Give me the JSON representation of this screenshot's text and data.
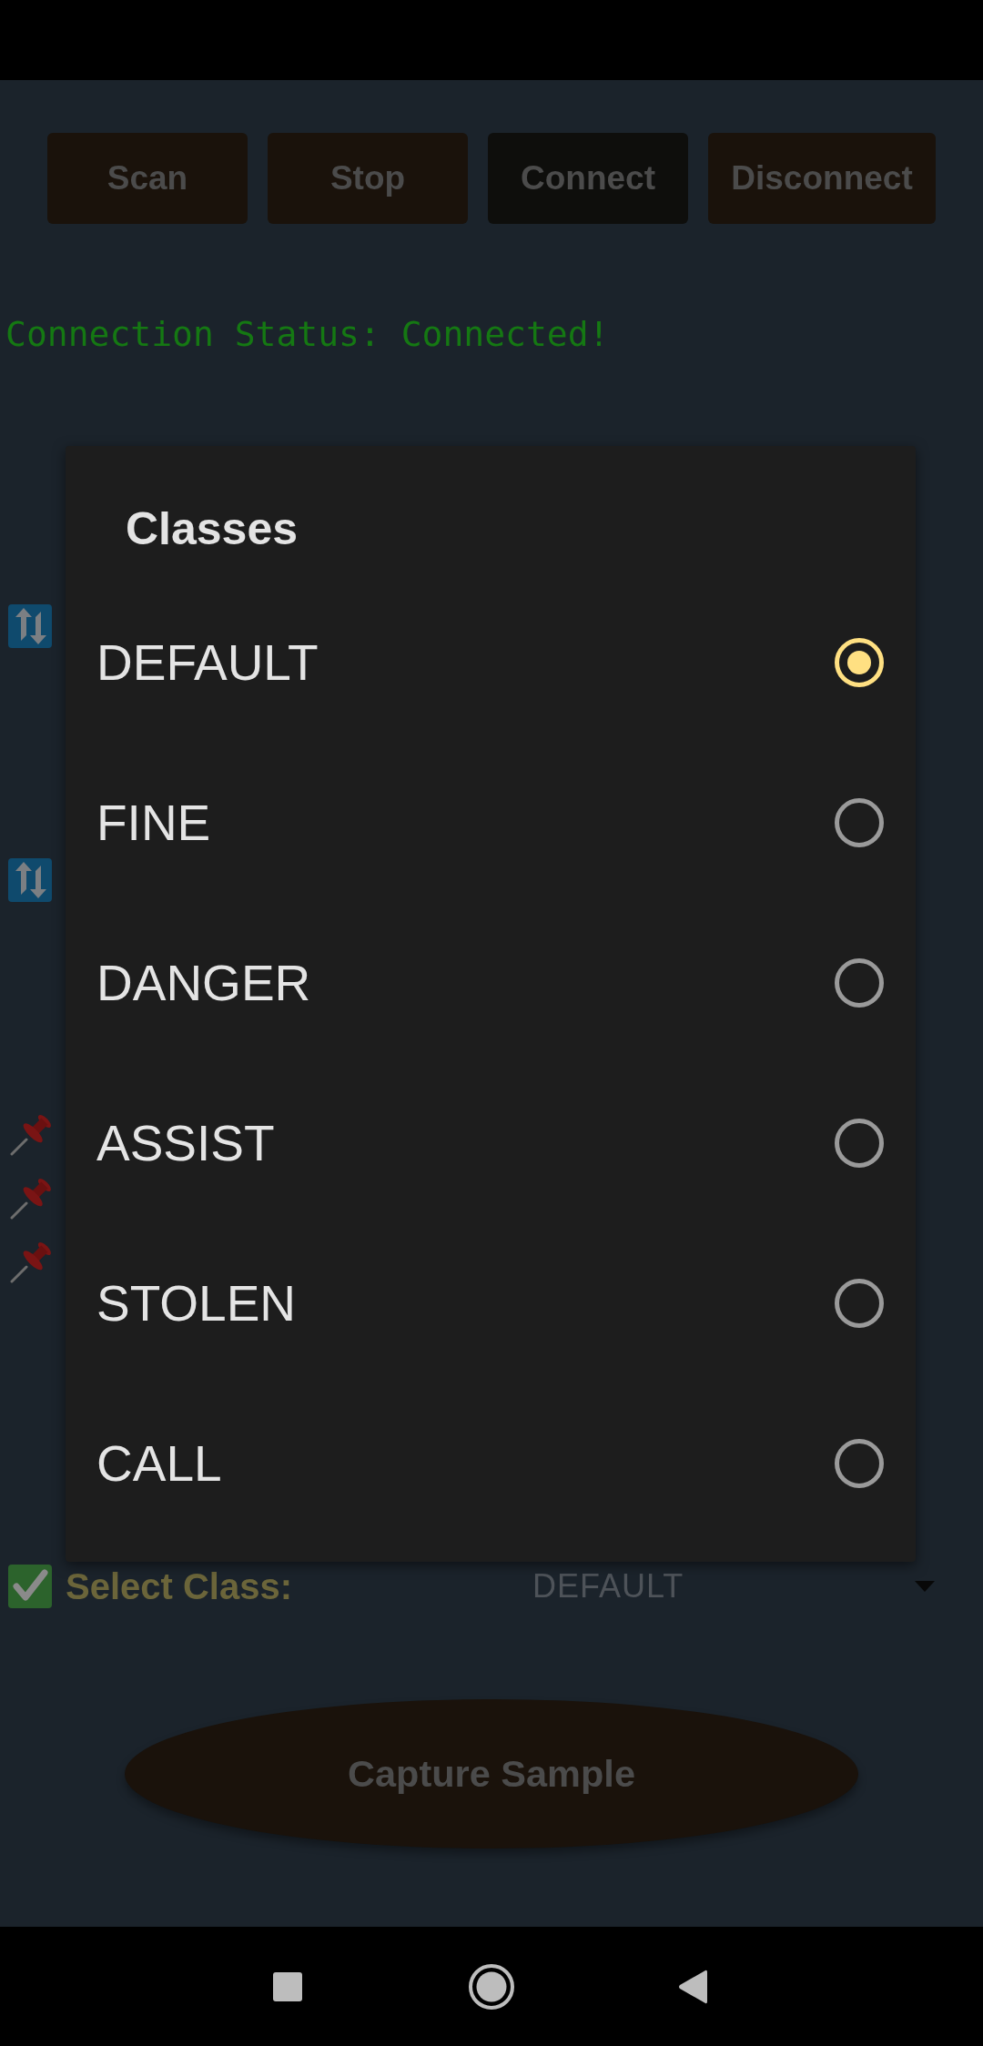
{
  "toolbar": {
    "buttons": [
      {
        "label": "Scan",
        "color": "#1a120b"
      },
      {
        "label": "Stop",
        "color": "#1a120b"
      },
      {
        "label": "Connect",
        "color": "#0e0e0c"
      },
      {
        "label": "Disconnect",
        "color": "#1a120b"
      }
    ]
  },
  "connection_status": "Connection Status: Connected!",
  "dialog": {
    "title": "Classes",
    "options": [
      {
        "label": "DEFAULT",
        "selected": true
      },
      {
        "label": "FINE",
        "selected": false
      },
      {
        "label": "DANGER",
        "selected": false
      },
      {
        "label": "ASSIST",
        "selected": false
      },
      {
        "label": "STOLEN",
        "selected": false
      },
      {
        "label": "CALL",
        "selected": false
      }
    ]
  },
  "select_class": {
    "label": "Select Class:",
    "value": "DEFAULT"
  },
  "capture_button": {
    "label": "Capture Sample"
  }
}
